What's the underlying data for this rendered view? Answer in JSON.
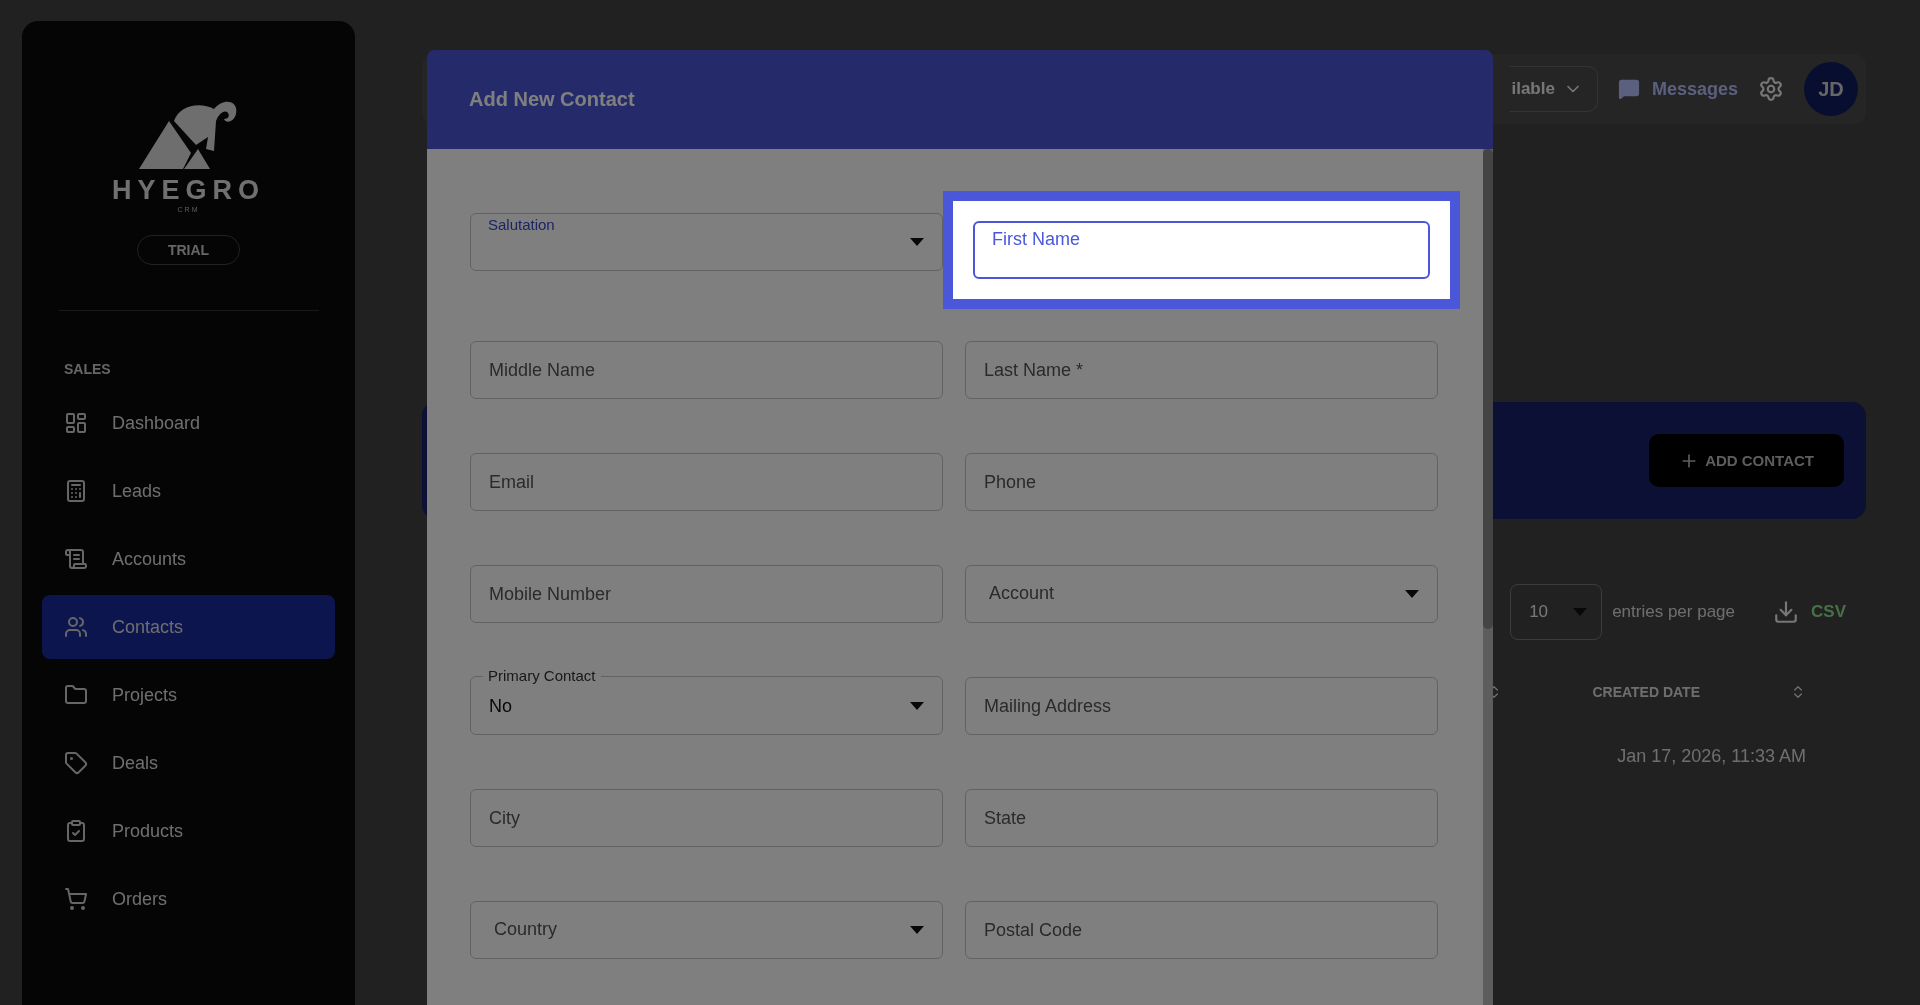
{
  "sidebar": {
    "logo": {
      "name": "HYEGRO",
      "sub": "CRM"
    },
    "plan_badge": "TRIAL",
    "section": "SALES",
    "items": [
      {
        "label": "Dashboard",
        "selected": false
      },
      {
        "label": "Leads",
        "selected": false
      },
      {
        "label": "Accounts",
        "selected": false
      },
      {
        "label": "Contacts",
        "selected": true
      },
      {
        "label": "Projects",
        "selected": false
      },
      {
        "label": "Deals",
        "selected": false
      },
      {
        "label": "Products",
        "selected": false
      },
      {
        "label": "Orders",
        "selected": false
      }
    ]
  },
  "top_bar": {
    "status_select": "ilable",
    "messages": "Messages",
    "avatar": "JD"
  },
  "banner": {
    "button": "ADD CONTACT"
  },
  "table": {
    "page_size": "10",
    "page_size_label": "entries per page",
    "export": "CSV",
    "columns": [
      "CREATED DATE"
    ],
    "rows": [
      [
        "Jan 17, 2026, 11:33 AM"
      ]
    ]
  },
  "modal": {
    "title": "Add New Contact",
    "fields": [
      {
        "kind": "select",
        "label": "Salutation",
        "floating": true
      },
      {
        "kind": "text",
        "placeholder": "First Name",
        "focused": true
      },
      {
        "kind": "text",
        "placeholder": "Middle Name",
        "focused": false
      },
      {
        "kind": "text",
        "placeholder": "Last Name *",
        "focused": false
      },
      {
        "kind": "text",
        "placeholder": "Email",
        "focused": false
      },
      {
        "kind": "text",
        "placeholder": "Phone",
        "focused": false
      },
      {
        "kind": "text",
        "placeholder": "Mobile Number",
        "focused": false
      },
      {
        "kind": "select",
        "label": "Account",
        "floating": false
      },
      {
        "kind": "select",
        "label": "Primary Contact",
        "floating": true,
        "value": "No"
      },
      {
        "kind": "text",
        "placeholder": "Mailing Address",
        "focused": false
      },
      {
        "kind": "text",
        "placeholder": "City",
        "focused": false
      },
      {
        "kind": "text",
        "placeholder": "State",
        "focused": false
      },
      {
        "kind": "select",
        "label": "Country",
        "floating": false
      },
      {
        "kind": "text",
        "placeholder": "Postal Code",
        "focused": false
      }
    ]
  }
}
